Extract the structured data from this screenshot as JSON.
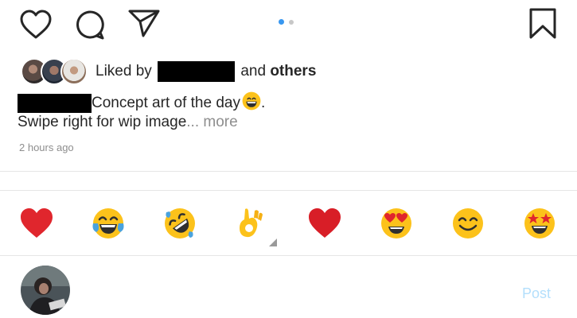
{
  "actions": {
    "like_icon": "heart-outline-icon",
    "comment_icon": "comment-bubble-icon",
    "share_icon": "paper-plane-icon",
    "save_icon": "bookmark-icon"
  },
  "carousel": {
    "count": 2,
    "active_index": 0,
    "active_color": "#3897f0",
    "inactive_color": "#c7c7c7"
  },
  "likes": {
    "prefix": "Liked by",
    "joiner": "and",
    "suffix": "others"
  },
  "caption": {
    "text": "Concept art of the day",
    "end": ".",
    "line2": "Swipe right for wip image",
    "ellipsis": "...",
    "more": "more",
    "emoji": "grinning-face-emoji"
  },
  "timestamp": "2 hours ago",
  "quick_reactions": [
    {
      "name": "red-heart-emoji"
    },
    {
      "name": "face-with-tears-of-joy-emoji"
    },
    {
      "name": "rolling-on-floor-laughing-emoji"
    },
    {
      "name": "ok-hand-emoji"
    },
    {
      "name": "red-heart-emoji"
    },
    {
      "name": "heart-eyes-emoji"
    },
    {
      "name": "smiling-face-emoji"
    },
    {
      "name": "star-struck-emoji"
    }
  ],
  "comment": {
    "post_label": "Post"
  },
  "colors": {
    "text": "#262626",
    "muted": "#8e8e8e",
    "post_disabled": "#b3dffc",
    "heart_red": "#e0262d",
    "emoji_yellow": "#fcc21b"
  }
}
